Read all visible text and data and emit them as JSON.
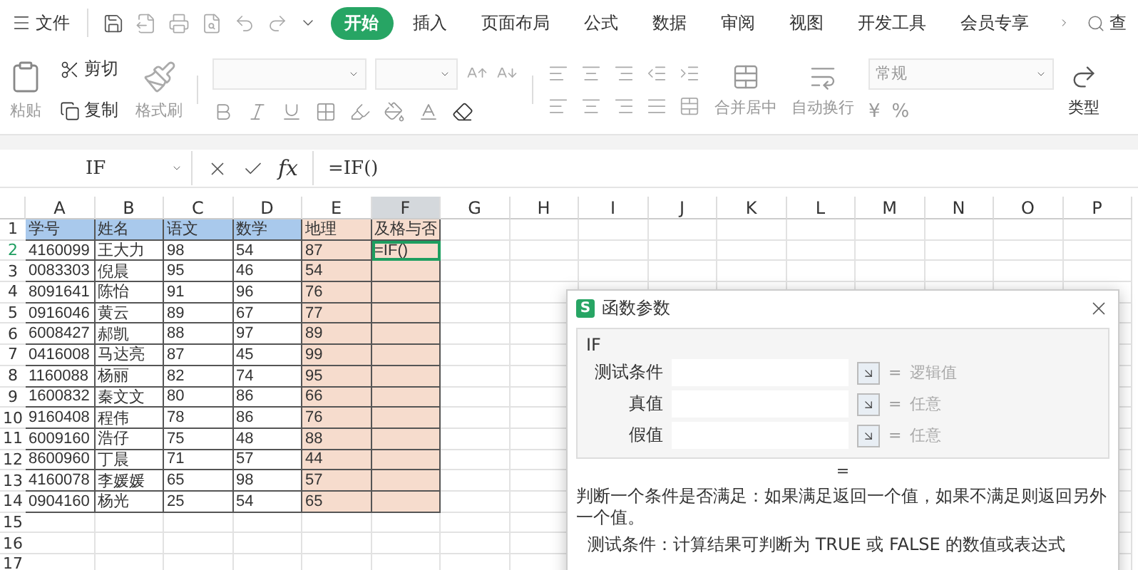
{
  "menu": {
    "file": "文件",
    "tabs": [
      {
        "label": "开始",
        "selected": true
      },
      {
        "label": "插入",
        "selected": false
      },
      {
        "label": "页面布局",
        "selected": false
      },
      {
        "label": "公式",
        "selected": false
      },
      {
        "label": "数据",
        "selected": false
      },
      {
        "label": "审阅",
        "selected": false
      },
      {
        "label": "视图",
        "selected": false
      },
      {
        "label": "开发工具",
        "selected": false
      },
      {
        "label": "会员专享",
        "selected": false
      }
    ],
    "search": "查"
  },
  "ribbon": {
    "paste": "粘贴",
    "cut": "剪切",
    "copy": "复制",
    "format_painter": "格式刷",
    "merge": "合并居中",
    "wrap": "自动换行",
    "number_format": "常规",
    "currency": "¥",
    "percent": "%",
    "convert": "类型"
  },
  "formula_bar": {
    "name_box": "IF",
    "fx": "fx",
    "formula": "=IF()"
  },
  "sheet": {
    "columns": [
      {
        "label": "A",
        "selected": false,
        "color": "#a9c9ec",
        "shaded": false
      },
      {
        "label": "B",
        "selected": false,
        "color": "#a9c9ec",
        "shaded": false
      },
      {
        "label": "C",
        "selected": false,
        "color": "#a9c9ec",
        "shaded": false
      },
      {
        "label": "D",
        "selected": false,
        "color": "#a9c9ec",
        "shaded": false
      },
      {
        "label": "E",
        "selected": false,
        "color": "#f6dccd",
        "shaded": true
      },
      {
        "label": "F",
        "selected": true,
        "color": "#f6dccd",
        "shaded": true
      },
      {
        "label": "G",
        "selected": false
      },
      {
        "label": "H",
        "selected": false
      },
      {
        "label": "I",
        "selected": false
      },
      {
        "label": "J",
        "selected": false
      },
      {
        "label": "K",
        "selected": false
      },
      {
        "label": "L",
        "selected": false
      },
      {
        "label": "M",
        "selected": false
      },
      {
        "label": "N",
        "selected": false
      },
      {
        "label": "O",
        "selected": false
      },
      {
        "label": "P",
        "selected": false
      }
    ],
    "rows": [
      {
        "number": "1",
        "selected": false,
        "cells": [
          "学号",
          "姓名",
          "语文",
          "数学",
          "地理",
          "及格与否"
        ]
      },
      {
        "number": "2",
        "selected": true,
        "cells": [
          "4160099",
          "王大力",
          "98",
          "54",
          "87",
          "=IF()"
        ]
      },
      {
        "number": "3",
        "selected": false,
        "cells": [
          "0083303",
          "倪晨",
          "95",
          "46",
          "54",
          ""
        ]
      },
      {
        "number": "4",
        "selected": false,
        "cells": [
          "8091641",
          "陈怡",
          "91",
          "96",
          "76",
          ""
        ]
      },
      {
        "number": "5",
        "selected": false,
        "cells": [
          "0916046",
          "黄云",
          "89",
          "67",
          "77",
          ""
        ]
      },
      {
        "number": "6",
        "selected": false,
        "cells": [
          "6008427",
          "郝凯",
          "88",
          "97",
          "89",
          ""
        ]
      },
      {
        "number": "7",
        "selected": false,
        "cells": [
          "0416008",
          "马达亮",
          "87",
          "45",
          "99",
          ""
        ]
      },
      {
        "number": "8",
        "selected": false,
        "cells": [
          "1160088",
          "杨丽",
          "82",
          "74",
          "95",
          ""
        ]
      },
      {
        "number": "9",
        "selected": false,
        "cells": [
          "1600832",
          "秦文文",
          "80",
          "86",
          "66",
          ""
        ]
      },
      {
        "number": "10",
        "selected": false,
        "cells": [
          "9160408",
          "程伟",
          "78",
          "86",
          "76",
          ""
        ]
      },
      {
        "number": "11",
        "selected": false,
        "cells": [
          "6009160",
          "浩仔",
          "75",
          "48",
          "88",
          ""
        ]
      },
      {
        "number": "12",
        "selected": false,
        "cells": [
          "8600960",
          "丁晨",
          "71",
          "57",
          "44",
          ""
        ]
      },
      {
        "number": "13",
        "selected": false,
        "cells": [
          "4160078",
          "李媛媛",
          "65",
          "98",
          "57",
          ""
        ]
      },
      {
        "number": "14",
        "selected": false,
        "cells": [
          "0904160",
          "杨光",
          "25",
          "54",
          "65",
          ""
        ]
      },
      {
        "number": "15",
        "selected": false,
        "cells": []
      },
      {
        "number": "16",
        "selected": false,
        "cells": []
      },
      {
        "number": "17",
        "selected": false,
        "cells": []
      }
    ]
  },
  "dialog": {
    "logo": "S",
    "title": "函数参数",
    "function": "IF",
    "args": [
      {
        "label": "测试条件",
        "equals": "=",
        "type": "逻辑值"
      },
      {
        "label": "真值",
        "equals": "=",
        "type": "任意"
      },
      {
        "label": "假值",
        "equals": "=",
        "type": "任意"
      }
    ],
    "result": "=",
    "description": "判断一个条件是否满足：如果满足返回一个值，如果不满足则返回另外一个值。",
    "arg_help": "测试条件：计算结果可判断为 TRUE 或 FALSE 的数值或表达式"
  }
}
